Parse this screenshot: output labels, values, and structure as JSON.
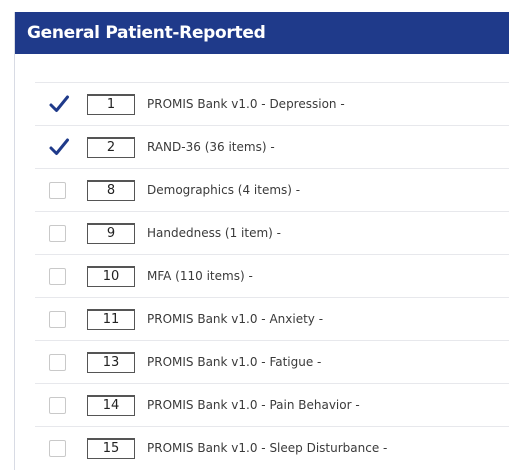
{
  "panel": {
    "title": "General Patient-Reported"
  },
  "items": [
    {
      "checked": true,
      "order": "1",
      "label": "PROMIS Bank v1.0 - Depression -"
    },
    {
      "checked": true,
      "order": "2",
      "label": "RAND-36 (36 items) -"
    },
    {
      "checked": false,
      "order": "8",
      "label": "Demographics (4 items) -"
    },
    {
      "checked": false,
      "order": "9",
      "label": "Handedness (1 item) -"
    },
    {
      "checked": false,
      "order": "10",
      "label": "MFA (110 items) -"
    },
    {
      "checked": false,
      "order": "11",
      "label": "PROMIS Bank v1.0 - Anxiety -"
    },
    {
      "checked": false,
      "order": "13",
      "label": "PROMIS Bank v1.0 - Fatigue -"
    },
    {
      "checked": false,
      "order": "14",
      "label": "PROMIS Bank v1.0 - Pain Behavior -"
    },
    {
      "checked": false,
      "order": "15",
      "label": "PROMIS Bank v1.0 - Sleep Disturbance -"
    }
  ],
  "colors": {
    "header_background": "#1f3a8a",
    "header_text": "#ffffff",
    "checkmark": "#1f3a8a"
  },
  "icons": {
    "checkmark": "checkmark-icon"
  }
}
